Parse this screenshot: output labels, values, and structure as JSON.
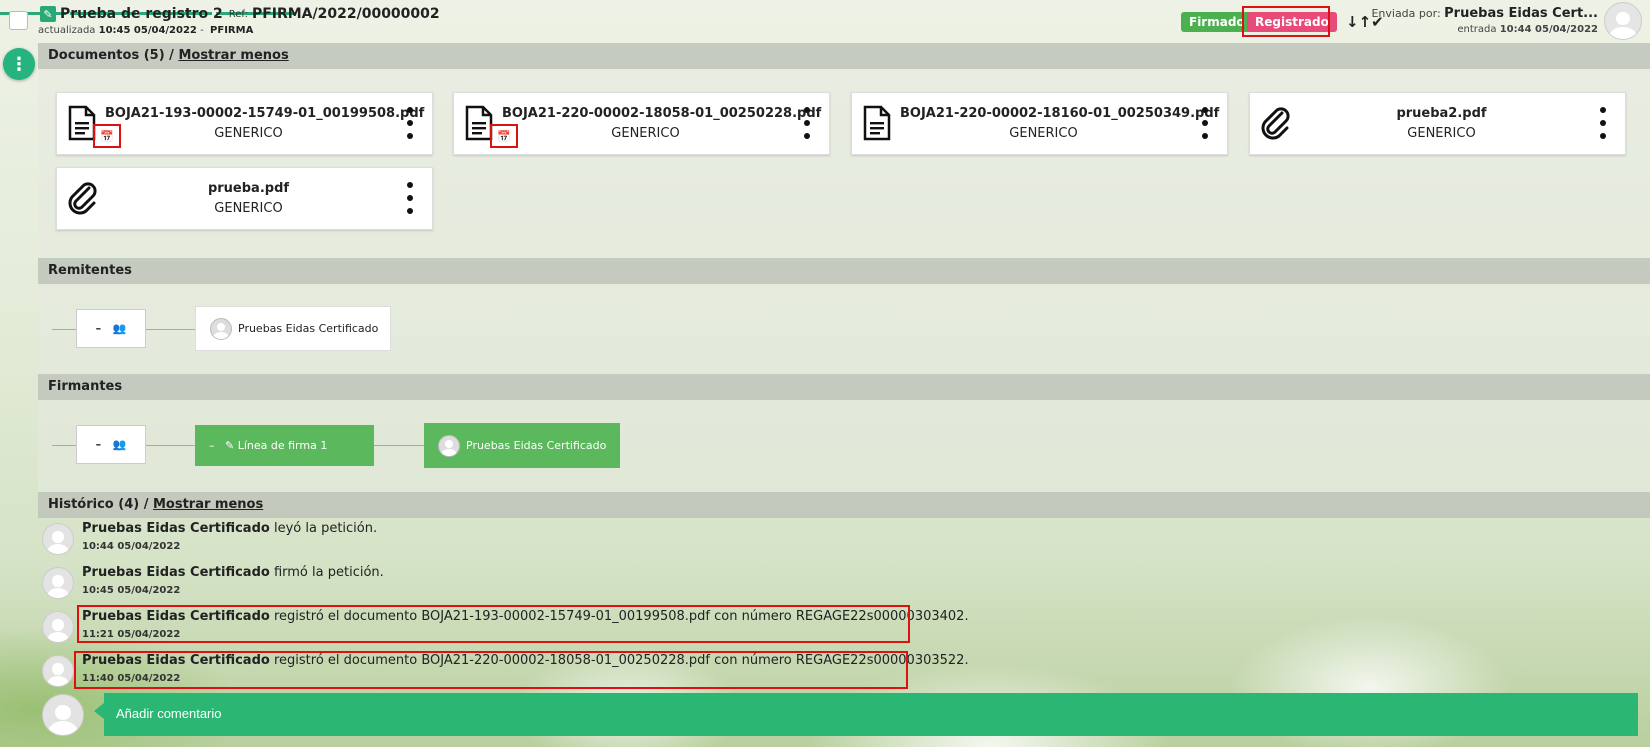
{
  "header": {
    "title": "Prueba de registro 2",
    "ref_label": "Ref:",
    "ref_value": "PFIRMA/2022/00000002",
    "updated_label": "actualizada",
    "updated_value": "10:45 05/04/2022",
    "updated_separator": "-",
    "app_name": "PFIRMA",
    "badge_signed": "Firmado",
    "badge_registered": "Registrado",
    "sort_icon": "sort-check-icon",
    "sender_label": "Enviada por:",
    "sender_name": "Pruebas Eidas Cert...",
    "entry_label": "entrada",
    "entry_value": "10:44 05/04/2022"
  },
  "documents": {
    "title_prefix": "Documentos (5) /",
    "toggle": "Mostrar menos",
    "items": [
      {
        "name": "BOJA21-193-00002-15749-01_00199508.pdf",
        "type": "GENERICO",
        "icon": "document-icon",
        "stamped": true
      },
      {
        "name": "BOJA21-220-00002-18058-01_00250228.pdf",
        "type": "GENERICO",
        "icon": "document-icon",
        "stamped": true
      },
      {
        "name": "BOJA21-220-00002-18160-01_00250349.pdf",
        "type": "GENERICO",
        "icon": "document-icon",
        "stamped": false
      },
      {
        "name": "prueba2.pdf",
        "type": "GENERICO",
        "icon": "paperclip-icon",
        "stamped": false
      },
      {
        "name": "prueba.pdf",
        "type": "GENERICO",
        "icon": "paperclip-icon",
        "stamped": false
      }
    ]
  },
  "senders": {
    "title": "Remitentes",
    "person": "Pruebas Eidas Certificado"
  },
  "signers": {
    "title": "Firmantes",
    "line_label": "Línea de firma 1",
    "person": "Pruebas Eidas Certificado"
  },
  "history": {
    "title_prefix": "Histórico (4) /",
    "toggle": "Mostrar menos",
    "items": [
      {
        "user": "Pruebas Eidas Certificado",
        "action": "leyó la petición.",
        "time": "10:44 05/04/2022"
      },
      {
        "user": "Pruebas Eidas Certificado",
        "action": "firmó la petición.",
        "time": "10:45 05/04/2022"
      },
      {
        "user": "Pruebas Eidas Certificado",
        "action": "registró el documento BOJA21-193-00002-15749-01_00199508.pdf con número REGAGE22s00000303402.",
        "time": "11:21 05/04/2022"
      },
      {
        "user": "Pruebas Eidas Certificado",
        "action": "registró el documento BOJA21-220-00002-18058-01_00250228.pdf con número REGAGE22s00000303522.",
        "time": "11:40 05/04/2022"
      }
    ]
  },
  "comment": {
    "placeholder": "Añadir comentario"
  },
  "colors": {
    "accent_green": "#2bb673",
    "signed_badge": "#4caf50",
    "registered_badge": "#e84a7a",
    "highlight_red": "#dd1111"
  }
}
